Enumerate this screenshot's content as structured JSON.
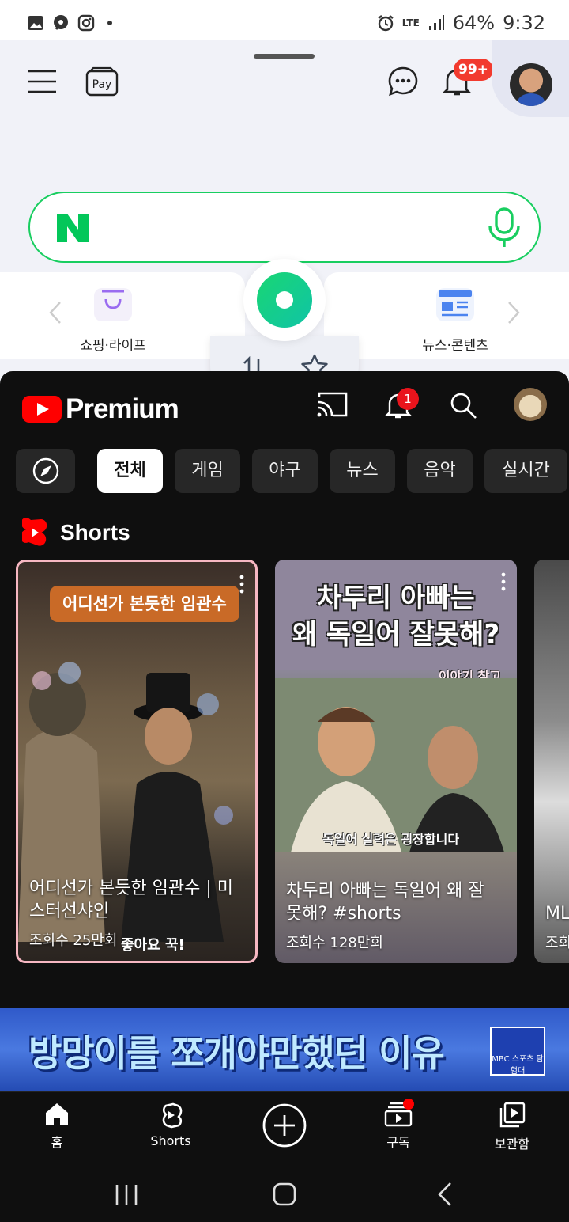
{
  "status_bar": {
    "battery": "64%",
    "time": "9:32",
    "network": "LTE"
  },
  "naver": {
    "notification_badge": "99+",
    "search_placeholder": "",
    "left_card_label": "쇼핑·라이프",
    "right_card_label": "뉴스·콘텐츠",
    "accent_color": "#19ce60"
  },
  "youtube": {
    "brand": "Premium",
    "notification_count": "1",
    "chips": [
      "전체",
      "게임",
      "야구",
      "뉴스",
      "음악",
      "실시간"
    ],
    "active_chip": "전체",
    "shorts_section_title": "Shorts",
    "shorts": [
      {
        "overlay": "어디선가 본듯한 임관수",
        "title": "어디선가 본듯한 임관수 | 미스터선샤인",
        "views": "조회수 25만회",
        "sticker": "좋아요 꾹!"
      },
      {
        "overlay_line1": "차두리 아빠는",
        "overlay_line2": "왜 독일어 잘못해?",
        "tag": "이야기 참고",
        "caption": "독일어 실력은 굉장합니다",
        "title": "차두리 아빠는 독일어 왜 잘못해? #shorts",
        "views": "조회수 128만회"
      },
      {
        "title": "ML",
        "views": "조회"
      }
    ],
    "banner_text": "방망이를 쪼개야만했던 이유",
    "banner_logo": "MBC 스포츠 탐험대",
    "nav": {
      "home": "홈",
      "shorts": "Shorts",
      "subscriptions": "구독",
      "library": "보관함"
    }
  }
}
